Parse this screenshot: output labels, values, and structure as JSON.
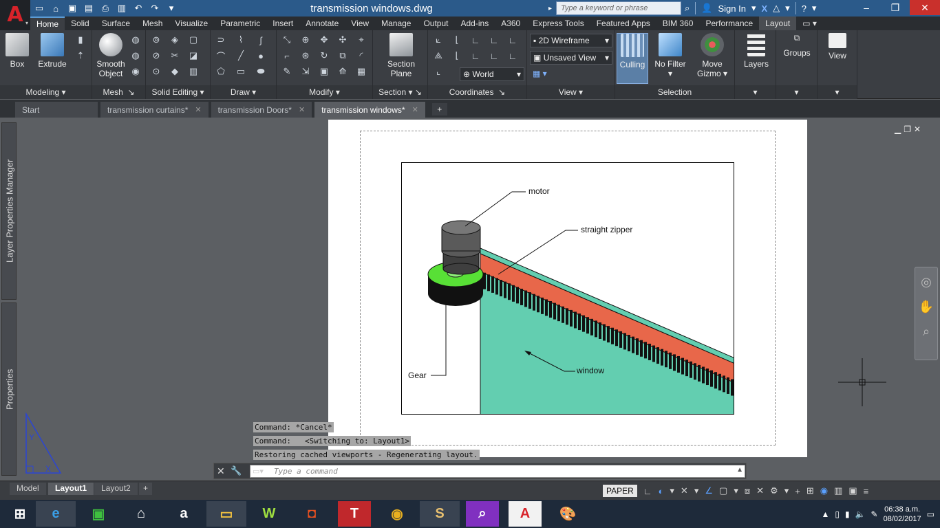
{
  "app": {
    "title": "transmission windows.dwg",
    "search_placeholder": "Type a keyword or phrase",
    "sign_in": "Sign In"
  },
  "ribbon_tabs": [
    "Home",
    "Solid",
    "Surface",
    "Mesh",
    "Visualize",
    "Parametric",
    "Insert",
    "Annotate",
    "View",
    "Manage",
    "Output",
    "Add-ins",
    "A360",
    "Express Tools",
    "Featured Apps",
    "BIM 360",
    "Performance",
    "Layout"
  ],
  "ribbon": {
    "panels": {
      "modeling": "Modeling",
      "mesh": "Mesh",
      "solid_editing": "Solid Editing",
      "draw": "Draw",
      "modify": "Modify",
      "section": "Section",
      "coordinates": "Coordinates",
      "view": "View",
      "selection": "Selection"
    },
    "buttons": {
      "box": "Box",
      "extrude": "Extrude",
      "smooth_object_1": "Smooth",
      "smooth_object_2": "Object",
      "section_plane_1": "Section",
      "section_plane_2": "Plane",
      "culling": "Culling",
      "no_filter": "No Filter",
      "move_gizmo_1": "Move",
      "move_gizmo_2": "Gizmo",
      "layers": "Layers",
      "groups": "Groups",
      "view": "View"
    },
    "dropdowns": {
      "visual_style": "2D Wireframe",
      "saved_view": "Unsaved View",
      "ucs": "World"
    }
  },
  "doc_tabs": [
    {
      "label": "Start",
      "closable": false,
      "active": false
    },
    {
      "label": "transmission curtains*",
      "closable": true,
      "active": false
    },
    {
      "label": "transmission Doors*",
      "closable": true,
      "active": false
    },
    {
      "label": "transmission windows*",
      "closable": true,
      "active": true
    }
  ],
  "palettes": {
    "layer_manager": "Layer Properties Manager",
    "properties": "Properties"
  },
  "drawing": {
    "labels": {
      "motor": "motor",
      "zipper": "straight zipper",
      "gear": "Gear",
      "window": "window"
    },
    "colors": {
      "gear": "#58e036",
      "zipper": "#e8674a",
      "window": "#63ceb0",
      "motor": "#5a5a5a"
    }
  },
  "command_history": [
    "Command: *Cancel*",
    "Command:   <Switching to: Layout1>",
    "Restoring cached viewports - Regenerating layout."
  ],
  "command_placeholder": "Type a command",
  "layout_tabs": [
    {
      "label": "Model",
      "active": false
    },
    {
      "label": "Layout1",
      "active": true
    },
    {
      "label": "Layout2",
      "active": false
    }
  ],
  "status": {
    "paper": "PAPER"
  },
  "taskbar": {
    "time": "06:38 a.m.",
    "date": "08/02/2017"
  }
}
